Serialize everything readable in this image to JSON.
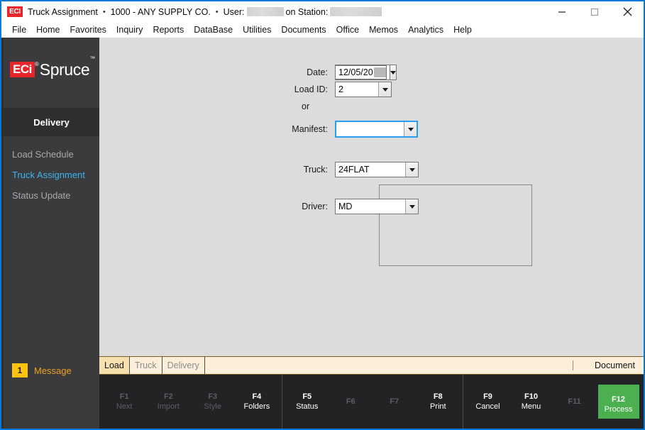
{
  "window": {
    "app_badge": "ECI",
    "title": "Truck Assignment",
    "separator": "•",
    "company": "1000 - ANY SUPPLY CO.",
    "user_label": "User:",
    "station_label": "on Station:",
    "minimize_name": "minimize",
    "maximize_name": "maximize",
    "close_name": "close"
  },
  "menubar": {
    "items": [
      {
        "label": "File"
      },
      {
        "label": "Home"
      },
      {
        "label": "Favorites"
      },
      {
        "label": "Inquiry"
      },
      {
        "label": "Reports"
      },
      {
        "label": "DataBase"
      },
      {
        "label": "Utilities"
      },
      {
        "label": "Documents"
      },
      {
        "label": "Office"
      },
      {
        "label": "Memos"
      },
      {
        "label": "Analytics"
      },
      {
        "label": "Help"
      }
    ]
  },
  "sidebar": {
    "logo": {
      "mark": "ECi",
      "registered": "®",
      "word": "Spruce",
      "tm": "™"
    },
    "section_title": "Delivery",
    "items": [
      {
        "label": "Load Schedule",
        "active": false
      },
      {
        "label": "Truck Assignment",
        "active": true
      },
      {
        "label": "Status Update",
        "active": false
      }
    ],
    "message": {
      "count": "1",
      "label": "Message"
    }
  },
  "form": {
    "date": {
      "label": "Date:",
      "value": "12/05/20",
      "redacted": true
    },
    "load_id": {
      "label": "Load ID:",
      "value": "2"
    },
    "or": "or",
    "manifest": {
      "label": "Manifest:",
      "value": "",
      "focused": true
    },
    "truck": {
      "label": "Truck:",
      "value": "24FLAT"
    },
    "driver": {
      "label": "Driver:",
      "value": "MD"
    }
  },
  "tabstrip": {
    "tabs": [
      {
        "label": "Load",
        "active": true
      },
      {
        "label": "Truck",
        "active": false
      },
      {
        "label": "Delivery",
        "active": false
      }
    ],
    "document_label": "Document"
  },
  "function_bar": {
    "group1": [
      {
        "key": "F1",
        "name": "Next",
        "enabled": false
      },
      {
        "key": "F2",
        "name": "Import",
        "enabled": false
      },
      {
        "key": "F3",
        "name": "Style",
        "enabled": false
      },
      {
        "key": "F4",
        "name": "Folders",
        "enabled": true
      }
    ],
    "group2": [
      {
        "key": "F5",
        "name": "Status",
        "enabled": true
      },
      {
        "key": "F6",
        "name": "",
        "enabled": false
      },
      {
        "key": "F7",
        "name": "",
        "enabled": false
      },
      {
        "key": "F8",
        "name": "Print",
        "enabled": true
      }
    ],
    "group3": [
      {
        "key": "F9",
        "name": "Cancel",
        "enabled": true
      },
      {
        "key": "F10",
        "name": "Menu",
        "enabled": true
      },
      {
        "key": "F11",
        "name": "",
        "enabled": false
      },
      {
        "key": "F12",
        "name": "Process",
        "enabled": true,
        "primary": true
      }
    ]
  },
  "colors": {
    "accent_blue": "#0078d7",
    "brand_red": "#e8252a",
    "link_blue": "#3eb3f0",
    "process_green": "#4caf50",
    "message_amber": "#ffc20e",
    "sidebar_dark": "#3b3b3d",
    "content_gray": "#dcdcdc",
    "tabstrip_cream": "#fbefd9"
  }
}
